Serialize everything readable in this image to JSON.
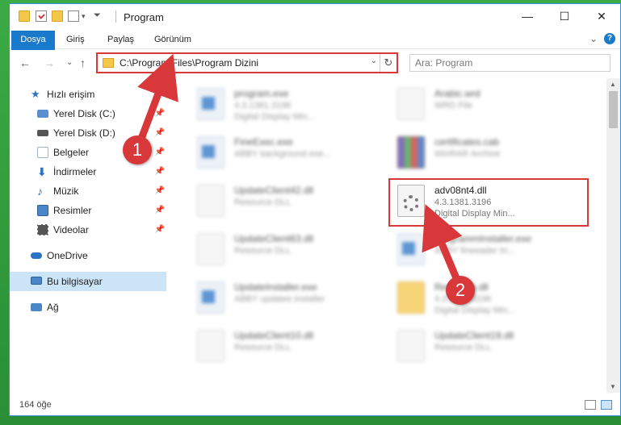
{
  "window": {
    "title": "Program",
    "controls": {
      "minimize": "—",
      "maximize": "☐",
      "close": "✕"
    }
  },
  "ribbon": {
    "tabs": [
      "Dosya",
      "Giriş",
      "Paylaş",
      "Görünüm"
    ],
    "help": "?"
  },
  "navigation": {
    "back": "←",
    "forward": "→",
    "recent": "⌄",
    "up": "↑",
    "address": "C:\\Program Files\\Program Dizini",
    "dropdown": "⌄",
    "refresh": "↻",
    "search_placeholder": "Ara: Program"
  },
  "sidebar": {
    "items": [
      {
        "label": "Hızlı erişim",
        "icon": "star-icon",
        "color": "#2a73c6"
      },
      {
        "label": "Yerel Disk (C:)",
        "icon": "drive-icon",
        "color": "#5a8fcf",
        "pinned": "📌"
      },
      {
        "label": "Yerel Disk (D:)",
        "icon": "drive-icon",
        "color": "#555555",
        "pinned": "📌"
      },
      {
        "label": "Belgeler",
        "icon": "documents-icon",
        "color": "#9bb4d2",
        "pinned": "📌"
      },
      {
        "label": "İndirmeler",
        "icon": "download-icon",
        "color": "#2a73c6",
        "pinned": "📌"
      },
      {
        "label": "Müzik",
        "icon": "music-icon",
        "color": "#2a73c6",
        "pinned": "📌"
      },
      {
        "label": "Resimler",
        "icon": "pictures-icon",
        "color": "#4b87c8",
        "pinned": "📌"
      },
      {
        "label": "Videolar",
        "icon": "videos-icon",
        "color": "#555555",
        "pinned": "📌"
      },
      {
        "label": "OneDrive",
        "icon": "cloud-icon",
        "color": "#2a73c6"
      },
      {
        "label": "Bu bilgisayar",
        "icon": "computer-icon",
        "color": "#4b87c8"
      },
      {
        "label": "Ağ",
        "icon": "network-icon",
        "color": "#4b87c8"
      }
    ]
  },
  "files": [
    {
      "name": "program.exe",
      "line2": "4.3.1381.3196",
      "line3": "Digital Display Min...",
      "type": "exe"
    },
    {
      "name": "Arabic.wrd",
      "line2": "WRD File",
      "line3": "",
      "type": "doc"
    },
    {
      "name": "FineExec.exe",
      "line2": "ABBY background exe...",
      "line3": "",
      "type": "exe"
    },
    {
      "name": "certificates.cab",
      "line2": "WinRAR Archive",
      "line3": "",
      "type": "rar"
    },
    {
      "name": "UpdateClient42.dll",
      "line2": "Resource DLL",
      "line3": "",
      "type": "doc"
    },
    {
      "name": "adv08nt4.dll",
      "line2": "4.3.1381.3196",
      "line3": "Digital Display Min...",
      "type": "dll"
    },
    {
      "name": "UpdateClient63.dll",
      "line2": "Resource DLL",
      "line3": "",
      "type": "doc"
    },
    {
      "name": "ProgrammInstaller.exe",
      "line2": "ABBY fineeader tri...",
      "line3": "",
      "type": "exe"
    },
    {
      "name": "UpdateInstaller.exe",
      "line2": "ABBY updates installer",
      "line3": "",
      "type": "exe"
    },
    {
      "name": "Resource.dll",
      "line2": "4.3.1381.3196",
      "line3": "Digital Display Min...",
      "type": "folder"
    },
    {
      "name": "UpdateClient10.dll",
      "line2": "Resource DLL",
      "line3": "",
      "type": "doc"
    },
    {
      "name": "UpdateClient19.dll",
      "line2": "Resource DLL",
      "line3": "",
      "type": "doc"
    }
  ],
  "status": {
    "count": "164 öğe"
  },
  "annotations": {
    "step1": "1",
    "step2": "2"
  },
  "colors": {
    "accent": "#1979ca",
    "highlight": "#d9383a",
    "selected": "#cce4f7"
  }
}
